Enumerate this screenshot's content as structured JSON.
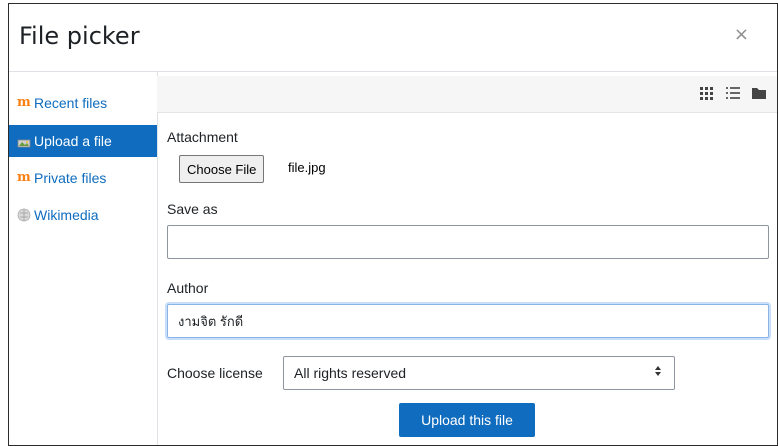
{
  "dialog": {
    "title": "File picker",
    "close_label": "×"
  },
  "sidebar": {
    "items": [
      {
        "label": "Recent files",
        "icon": "moodle-icon",
        "active": false
      },
      {
        "label": "Upload a file",
        "icon": "upload-icon",
        "active": true
      },
      {
        "label": "Private files",
        "icon": "moodle-icon",
        "active": false
      },
      {
        "label": "Wikimedia",
        "icon": "wikimedia-icon",
        "active": false
      }
    ]
  },
  "toolbar": {
    "views": [
      "grid-view-icon",
      "list-view-icon",
      "folder-view-icon"
    ]
  },
  "form": {
    "attachment_label": "Attachment",
    "choose_file_label": "Choose File",
    "file_name": "file.jpg",
    "save_as_label": "Save as",
    "save_as_value": "",
    "author_label": "Author",
    "author_value": "งามจิต รักดี",
    "license_label": "Choose license",
    "license_value": "All rights reserved",
    "upload_button_label": "Upload this file"
  },
  "colors": {
    "accent": "#0f6cbf",
    "moodle_orange": "#f98012"
  }
}
